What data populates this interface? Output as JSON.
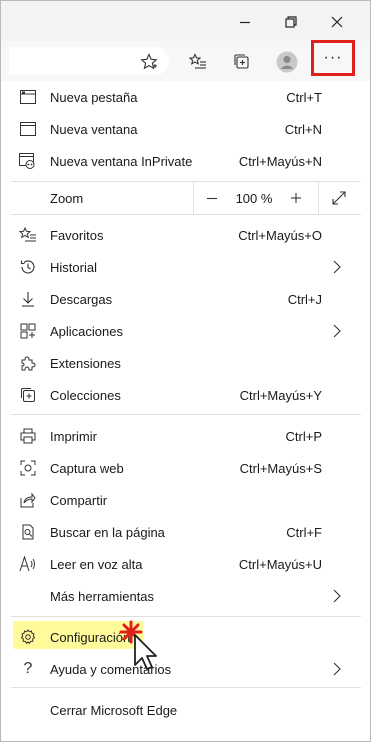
{
  "window": {
    "minimize_icon": "minimize-icon",
    "restore_icon": "restore-icon",
    "close_icon": "close-icon"
  },
  "toolbar": {
    "star_icon": "favorite-star-icon",
    "favorites_icon": "favorites-list-icon",
    "collections_icon": "collections-icon",
    "profile_icon": "profile-avatar-icon",
    "menu_label": "···",
    "menu_highlight_color": "#e0201b"
  },
  "menu": {
    "new_tab": {
      "label": "Nueva pestaña",
      "shortcut": "Ctrl+T"
    },
    "new_window": {
      "label": "Nueva ventana",
      "shortcut": "Ctrl+N"
    },
    "new_inprivate": {
      "label": "Nueva ventana InPrivate",
      "shortcut": "Ctrl+Mayús+N"
    },
    "zoom": {
      "label": "Zoom",
      "minus": "—",
      "value": "100 %",
      "plus": "+"
    },
    "favorites": {
      "label": "Favoritos",
      "shortcut": "Ctrl+Mayús+O"
    },
    "history": {
      "label": "Historial"
    },
    "downloads": {
      "label": "Descargas",
      "shortcut": "Ctrl+J"
    },
    "apps": {
      "label": "Aplicaciones"
    },
    "extensions": {
      "label": "Extensiones"
    },
    "collections": {
      "label": "Colecciones",
      "shortcut": "Ctrl+Mayús+Y"
    },
    "print": {
      "label": "Imprimir",
      "shortcut": "Ctrl+P"
    },
    "web_capture": {
      "label": "Captura web",
      "shortcut": "Ctrl+Mayús+S"
    },
    "share": {
      "label": "Compartir"
    },
    "find": {
      "label": "Buscar en la página",
      "shortcut": "Ctrl+F"
    },
    "read_aloud": {
      "label": "Leer en voz alta",
      "shortcut": "Ctrl+Mayús+U"
    },
    "more_tools": {
      "label": "Más herramientas"
    },
    "settings": {
      "label": "Configuración",
      "highlight_color": "#fffb9a"
    },
    "help": {
      "label": "Ayuda y comentarios"
    },
    "close": {
      "label": "Cerrar Microsoft Edge"
    }
  }
}
